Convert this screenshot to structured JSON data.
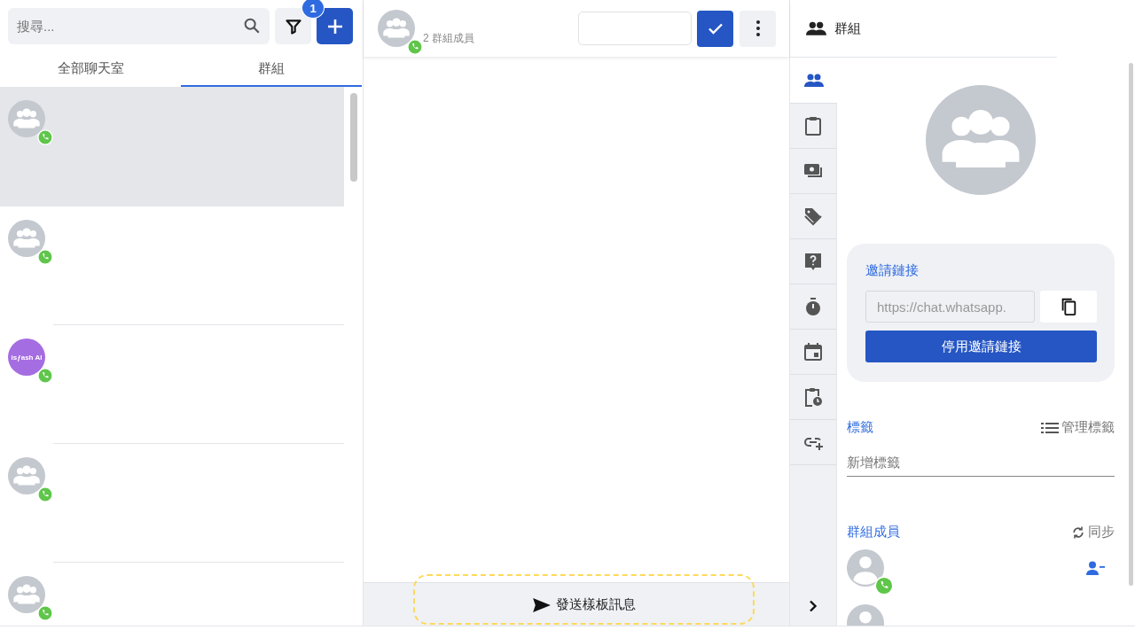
{
  "search": {
    "placeholder": "搜尋..."
  },
  "filter": {
    "badge": "1"
  },
  "tabs": [
    {
      "label": "全部聊天室",
      "selected": false
    },
    {
      "label": "群組",
      "selected": true
    }
  ],
  "chats": [
    {
      "selected": true,
      "avatar": {
        "kind": "group"
      },
      "whatsapp": true
    },
    {
      "selected": false,
      "avatar": {
        "kind": "group"
      },
      "whatsapp": true
    },
    {
      "selected": false,
      "avatar": {
        "kind": "logo",
        "text": "isƒash AI",
        "color": "#a56de2"
      },
      "whatsapp": true
    },
    {
      "selected": false,
      "avatar": {
        "kind": "group"
      },
      "whatsapp": true
    },
    {
      "selected": false,
      "avatar": {
        "kind": "group"
      },
      "whatsapp": true
    }
  ],
  "chat_header": {
    "subtitle": "2 群組成員",
    "whatsapp": true
  },
  "template_button": {
    "label": "發送樣板訊息"
  },
  "details": {
    "title": "群組",
    "rail": [
      {
        "kind": "people",
        "selected": true
      },
      {
        "kind": "clipboard",
        "selected": false
      },
      {
        "kind": "money",
        "selected": false
      },
      {
        "kind": "tag",
        "selected": false
      },
      {
        "kind": "help",
        "selected": false
      },
      {
        "kind": "timer",
        "selected": false
      },
      {
        "kind": "calendar",
        "selected": false
      },
      {
        "kind": "clipboard-clock",
        "selected": false
      },
      {
        "kind": "link-add",
        "selected": false
      }
    ],
    "invite": {
      "heading": "邀請鏈接",
      "link": "https://chat.whatsapp.",
      "disable_button": "停用邀請鏈接"
    },
    "tags": {
      "heading": "標籤",
      "manage": "管理標籤",
      "placeholder": "新增標籤"
    },
    "members": {
      "heading": "群組成員",
      "sync": "同步",
      "items": [
        {
          "whatsapp": true,
          "removable": true
        },
        {
          "whatsapp": false,
          "removable": false
        }
      ]
    }
  }
}
